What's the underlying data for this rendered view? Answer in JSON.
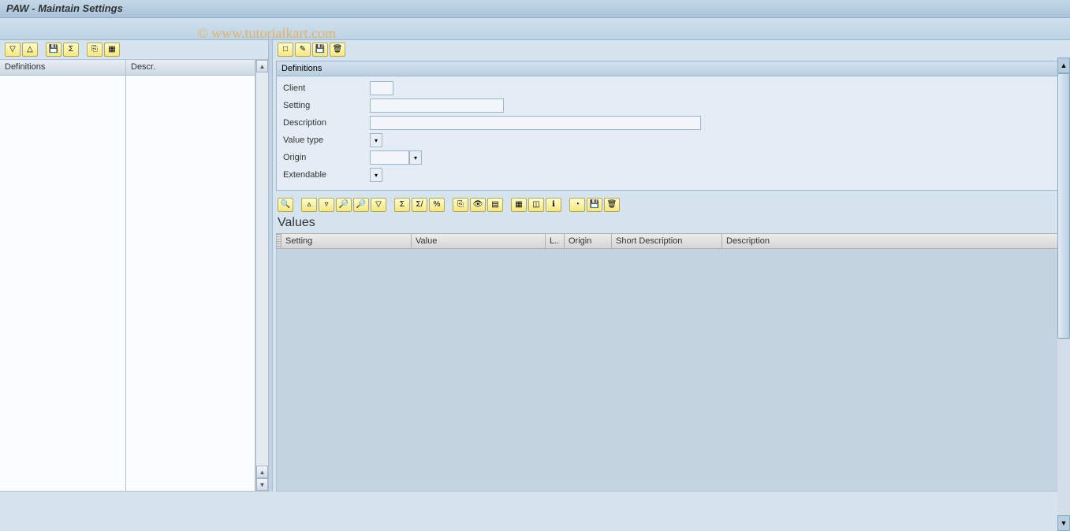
{
  "title": "PAW - Maintain Settings",
  "watermark": "© www.tutorialkart.com",
  "left": {
    "columns": [
      "Definitions",
      "Descr."
    ]
  },
  "definitions": {
    "panel_title": "Definitions",
    "fields": {
      "client": "Client",
      "setting": "Setting",
      "description": "Description",
      "value_type": "Value type",
      "origin": "Origin",
      "extendable": "Extendable"
    }
  },
  "values": {
    "title": "Values",
    "columns": [
      "Setting",
      "Value",
      "L..",
      "Origin",
      "Short Description",
      "Description"
    ]
  }
}
